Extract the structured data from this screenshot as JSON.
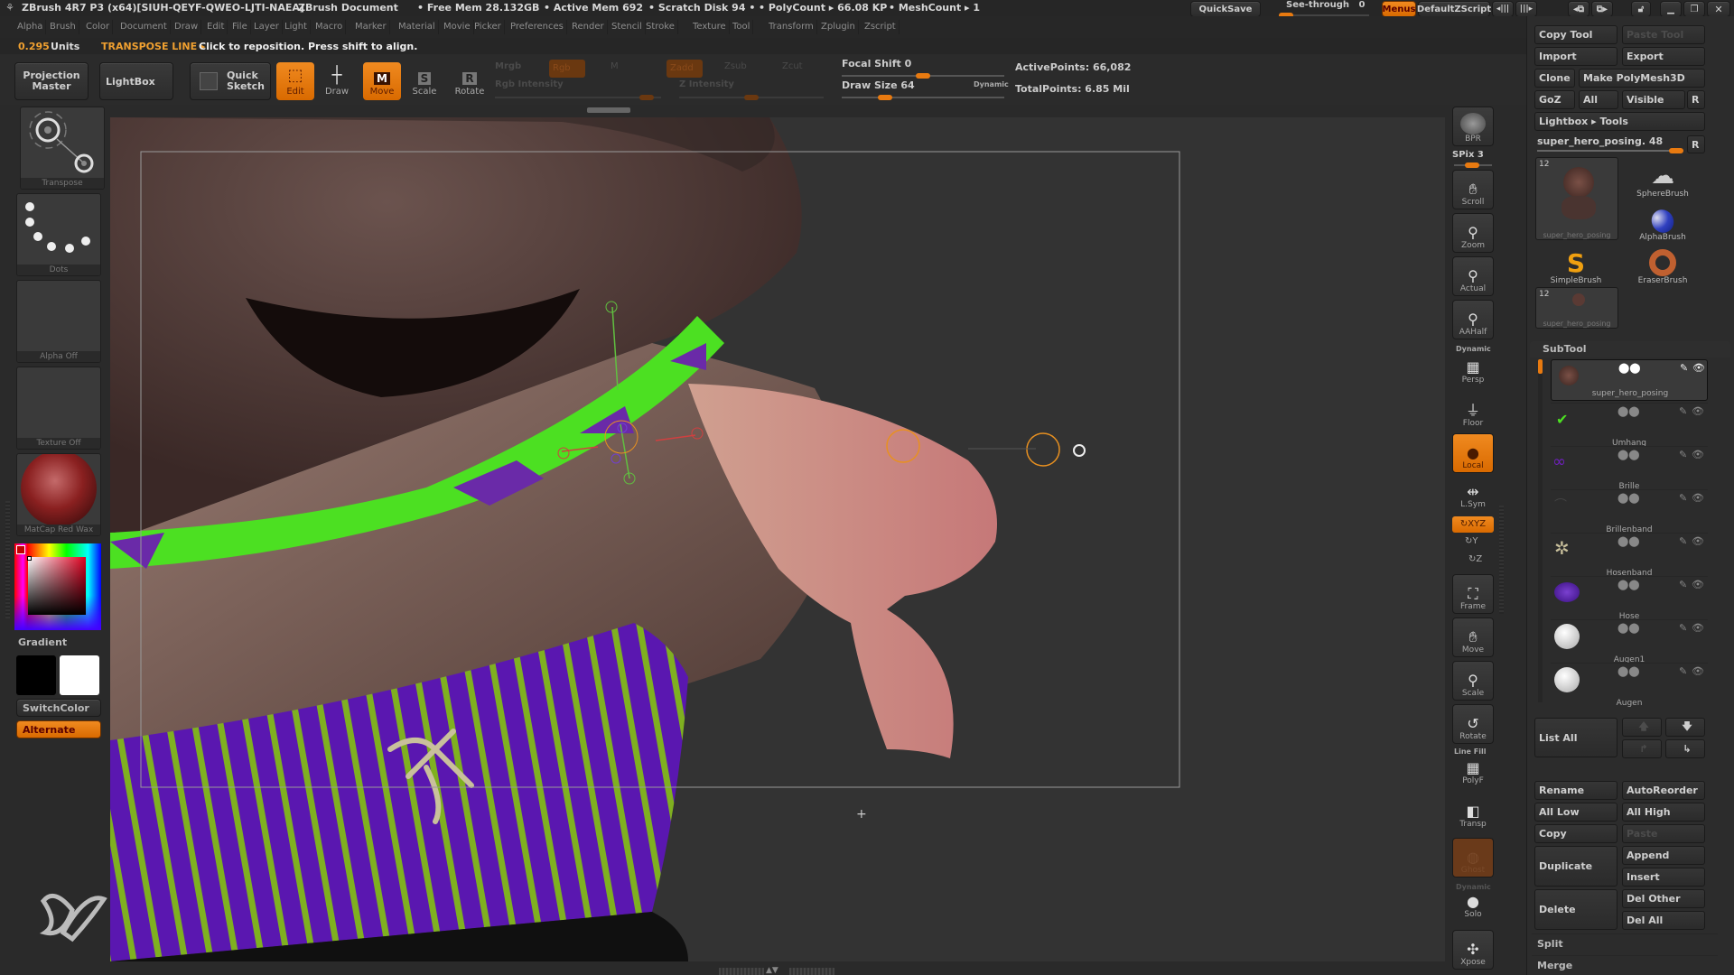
{
  "titlebar": {
    "app_title": "ZBrush 4R7 P3 (x64)[SIUH-QEYF-QWEO-LJTI-NAEA]",
    "document": "ZBrush Document",
    "free_mem": "• Free Mem 28.132GB",
    "active_mem": "• Active Mem 692",
    "scratch_disk": "• Scratch Disk 94 •",
    "poly_count": "• PolyCount ▸ 66.08 KP",
    "mesh_count": "• MeshCount ▸ 1",
    "quicksave": "QuickSave",
    "see_through_label": "See-through",
    "see_through_value": "0",
    "menus": "Menus",
    "default_zscript": "DefaultZScript"
  },
  "menus": [
    "Alpha",
    "Brush",
    "Color",
    "Document",
    "Draw",
    "Edit",
    "File",
    "Layer",
    "Light",
    "Macro",
    "Marker",
    "Material",
    "Movie",
    "Picker",
    "Preferences",
    "Render",
    "Stencil",
    "Stroke",
    "Texture",
    "Tool",
    "Transform",
    "Zplugin",
    "Zscript"
  ],
  "status": {
    "units_value": "0.295",
    "units_label": "Units",
    "mode": "TRANSPOSE LINE ▸",
    "hint": "Click to reposition. Press shift to align."
  },
  "toolbar": {
    "projection_master": "Projection Master",
    "lightbox": "LightBox",
    "quick_sketch": "Quick Sketch",
    "edit": "Edit",
    "draw": "Draw",
    "move": "Move",
    "scale": "Scale",
    "rotate": "Rotate",
    "mrgb": "Mrgb",
    "rgb": "Rgb",
    "m": "M",
    "rgb_intensity": "Rgb Intensity",
    "zadd": "Zadd",
    "zsub": "Zsub",
    "zcut": "Zcut",
    "z_intensity": "Z Intensity",
    "focal_shift": "Focal Shift 0",
    "draw_size": "Draw Size 64",
    "dynamic": "Dynamic",
    "active_points": "ActivePoints: 66,082",
    "total_points": "TotalPoints: 6.85 Mil"
  },
  "left_shelf": {
    "transpose": "Transpose",
    "dots": "Dots",
    "alpha": "Alpha Off",
    "texture": "Texture Off",
    "material": "MatCap Red Wax",
    "gradient": "Gradient",
    "switch_color": "SwitchColor",
    "alternate": "Alternate",
    "main_color": "#c00000",
    "secondary_color": "#ffffff"
  },
  "right_shelf": {
    "bpr": "BPR",
    "spix": "SPix 3",
    "scroll": "Scroll",
    "zoom": "Zoom",
    "actual": "Actual",
    "aahalf": "AAHalf",
    "dynamic": "Dynamic",
    "persp": "Persp",
    "floor": "Floor",
    "local": "Local",
    "lsym": "L.Sym",
    "xyz": "XYZ",
    "y": "Y",
    "z": "Z",
    "frame": "Frame",
    "move": "Move",
    "scale": "Scale",
    "rotate": "Rotate",
    "line_fill": "Line Fill",
    "polyf": "PolyF",
    "transp": "Transp",
    "ghost": "Ghost",
    "dynamic2": "Dynamic",
    "solo": "Solo",
    "xpose": "Xpose"
  },
  "tool_panel": {
    "copy_tool": "Copy Tool",
    "paste_tool": "Paste Tool",
    "import": "Import",
    "export": "Export",
    "clone": "Clone",
    "make_polymesh": "Make PolyMesh3D",
    "goz": "GoZ",
    "all": "All",
    "visible": "Visible",
    "r": "R",
    "lightbox_tools": "Lightbox ▸ Tools",
    "current_tool": "super_hero_posing. 48",
    "tools": [
      {
        "name": "super_hero_posing",
        "badge": "12"
      },
      {
        "name": "SphereBrush"
      },
      {
        "name": "AlphaBrush"
      },
      {
        "name": "SimpleBrush"
      },
      {
        "name": "EraserBrush"
      },
      {
        "name": "super_hero_posing",
        "badge": "12"
      }
    ]
  },
  "subtool": {
    "header": "SubTool",
    "items": [
      "super_hero_posing",
      "Umhang",
      "Brille",
      "Brillenband",
      "Hosenband",
      "Hose",
      "Augen1",
      "Augen"
    ],
    "list_all": "List All",
    "rename": "Rename",
    "auto_reorder": "AutoReorder",
    "all_low": "All Low",
    "all_high": "All High",
    "copy": "Copy",
    "paste": "Paste",
    "duplicate": "Duplicate",
    "append": "Append",
    "insert": "Insert",
    "delete": "Delete",
    "del_other": "Del Other",
    "del_all": "Del All",
    "split": "Split",
    "merge": "Merge"
  },
  "colors": {
    "accent": "#e87a10",
    "status_orange": "#f0a030"
  }
}
